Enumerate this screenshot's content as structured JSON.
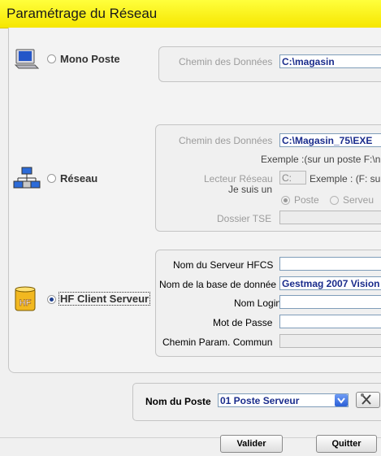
{
  "window": {
    "title": "Paramétrage du Réseau"
  },
  "mono": {
    "option_label": "Mono Poste",
    "selected": false,
    "path_label": "Chemin des Données",
    "path_value": "C:\\magasin"
  },
  "reseau": {
    "option_label": "Réseau",
    "selected": false,
    "path_label": "Chemin des Données",
    "path_value": "C:\\Magasin_75\\EXE",
    "example_text": "Exemple :(sur un poste F:\\n",
    "drive_label": "Lecteur Réseau",
    "drive_value": "C:",
    "drive_example": "Exemple : (F: su",
    "role_label": "Je suis un",
    "role_option1": "Poste",
    "role_option2": "Serveu",
    "tse_label": "Dossier TSE",
    "tse_value": ""
  },
  "hf": {
    "option_label": "HF Client Serveur",
    "selected": true,
    "server_label": "Nom du Serveur HFCS",
    "server_value": "",
    "db_label": "Nom de la base de donnée",
    "db_value": "Gestmag 2007 Vision",
    "login_label": "Nom Login",
    "login_value": "",
    "password_label": "Mot de Passe",
    "password_value": "",
    "common_label": "Chemin Param. Commun",
    "common_value": ""
  },
  "poste": {
    "label": "Nom du Poste",
    "value": "01    Poste Serveur"
  },
  "buttons": {
    "validate": "Valider",
    "quit": "Quitter"
  },
  "colors": {
    "title_bar": "#ffff3c",
    "field_text": "#1a2c8c",
    "selected_radio": "#1e3f8f"
  }
}
